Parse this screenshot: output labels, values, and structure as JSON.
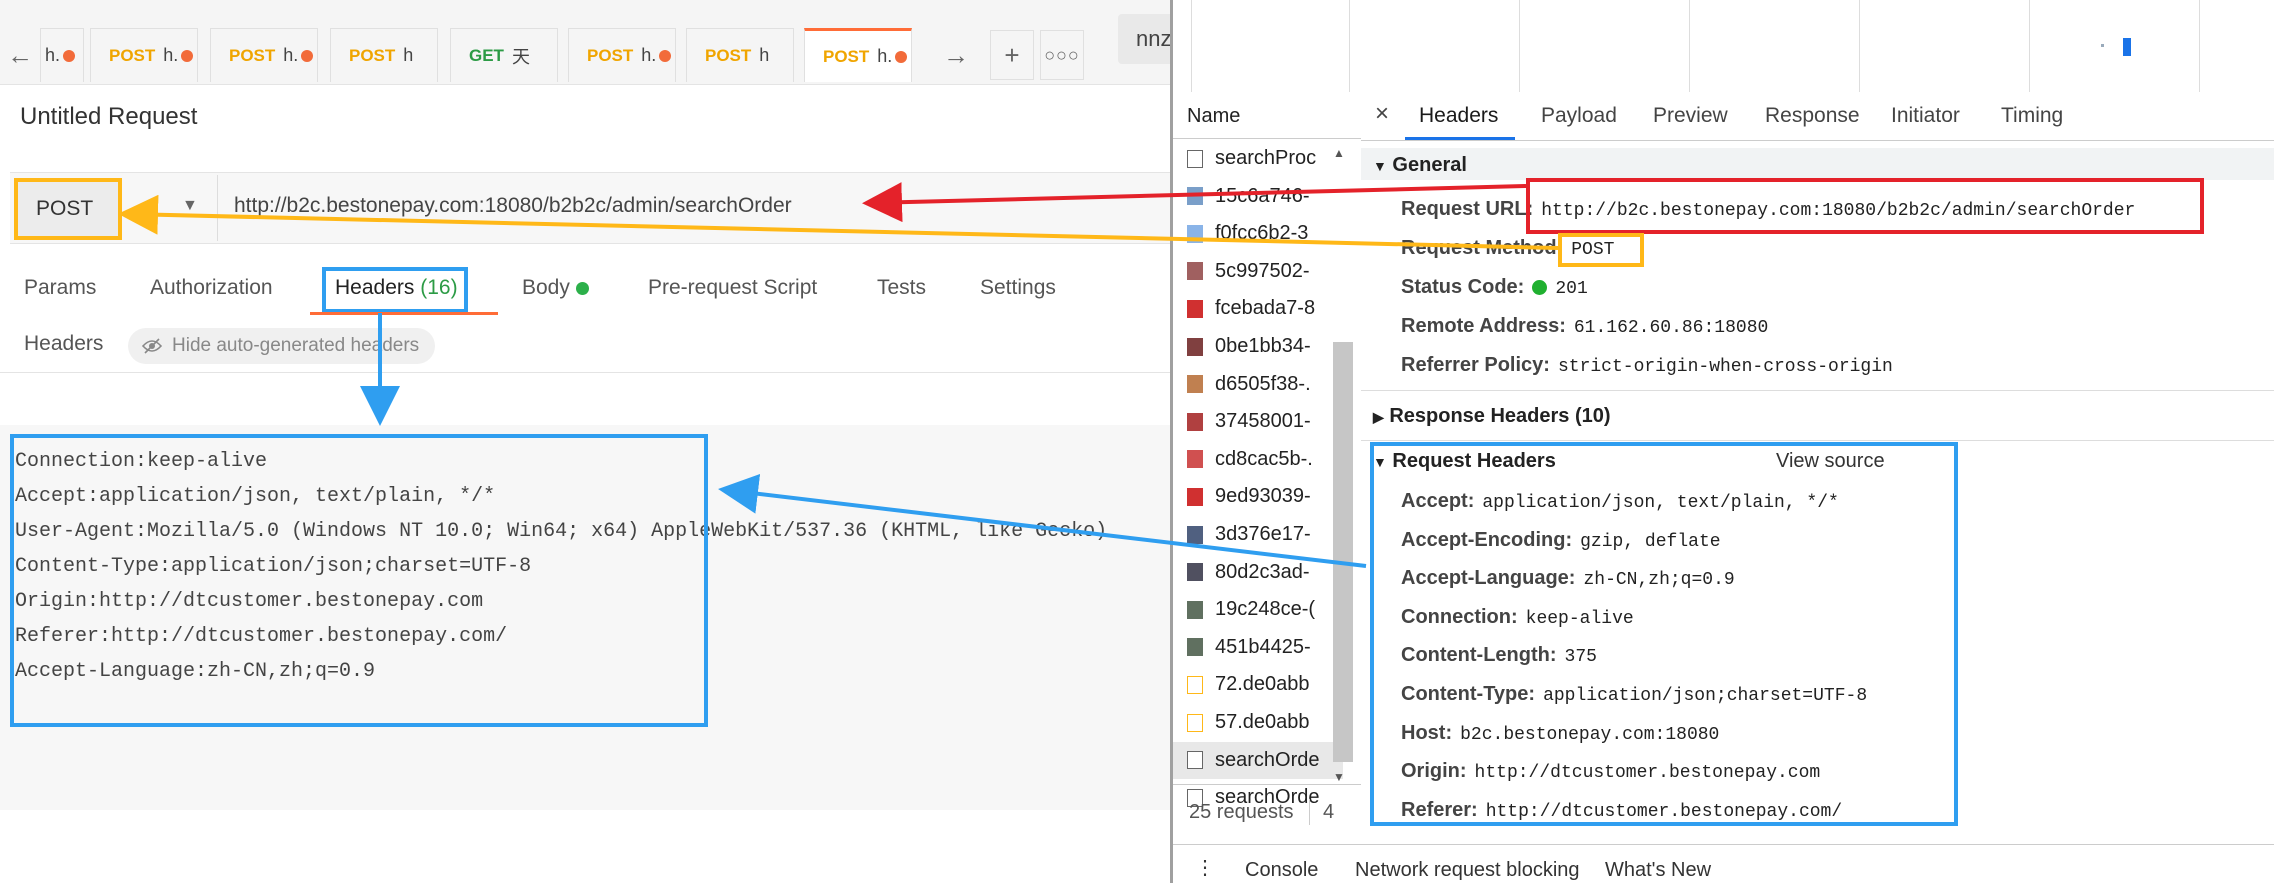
{
  "postman": {
    "tabs": [
      {
        "method": "",
        "label": "h.",
        "dirty": true
      },
      {
        "method": "POST",
        "label": "h.",
        "dirty": true
      },
      {
        "method": "POST",
        "label": "h.",
        "dirty": true
      },
      {
        "method": "POST",
        "label": "h",
        "dirty": false
      },
      {
        "method": "GET",
        "label": "天",
        "dirty": false
      },
      {
        "method": "POST",
        "label": "h.",
        "dirty": true
      },
      {
        "method": "POST",
        "label": "h",
        "dirty": false
      },
      {
        "method": "POST",
        "label": "h.",
        "dirty": true
      }
    ],
    "workspace_label": "nnz",
    "request_title": "Untitled Request",
    "method": "POST",
    "url": "http://b2c.bestonepay.com:18080/b2b2c/admin/searchOrder",
    "request_tabs": {
      "params": "Params",
      "authorization": "Authorization",
      "headers": "Headers",
      "headers_count": "(16)",
      "body": "Body",
      "prerequest": "Pre-request Script",
      "tests": "Tests",
      "settings": "Settings"
    },
    "headers_section": "Headers",
    "hide_auto": "Hide auto-generated headers",
    "bulk_headers": [
      "Connection:keep-alive",
      "Accept:application/json, text/plain, */*",
      "User-Agent:Mozilla/5.0 (Windows NT 10.0; Win64; x64) AppleWebKit/537.36 (KHTML, like Gecko)",
      "Content-Type:application/json;charset=UTF-8",
      "Origin:http://dtcustomer.bestonepay.com",
      "Referer:http://dtcustomer.bestonepay.com/",
      "Accept-Language:zh-CN,zh;q=0.9"
    ]
  },
  "devtools": {
    "name_header": "Name",
    "requests": [
      "searchProc",
      "15c6a746-",
      "f0fcc6b2-3",
      "5c997502-",
      "fcebada7-8",
      "0be1bb34-",
      "d6505f38-.",
      "37458001-",
      "cd8cac5b-.",
      "9ed93039-",
      "3d376e17-",
      "80d2c3ad-",
      "19c248ce-(",
      "451b4425-",
      "72.de0abb",
      "57.de0abb",
      "searchOrde",
      "searchOrde"
    ],
    "request_count": "25 requests",
    "request_count_extra": "4",
    "detail_tabs": [
      "Headers",
      "Payload",
      "Preview",
      "Response",
      "Initiator",
      "Timing"
    ],
    "close_label": "×",
    "general_title": "General",
    "general": [
      {
        "key": "Request URL:",
        "value": "http://b2c.bestonepay.com:18080/b2b2c/admin/searchOrder"
      },
      {
        "key": "Request Method:",
        "value": "POST"
      },
      {
        "key": "Status Code:",
        "value": "201"
      },
      {
        "key": "Remote Address:",
        "value": "61.162.60.86:18080"
      },
      {
        "key": "Referrer Policy:",
        "value": "strict-origin-when-cross-origin"
      }
    ],
    "response_headers_title": "Response Headers (10)",
    "request_headers_title": "Request Headers",
    "view_source": "View source",
    "request_headers": [
      {
        "key": "Accept:",
        "value": "application/json, text/plain, */*"
      },
      {
        "key": "Accept-Encoding:",
        "value": "gzip, deflate"
      },
      {
        "key": "Accept-Language:",
        "value": "zh-CN,zh;q=0.9"
      },
      {
        "key": "Connection:",
        "value": "keep-alive"
      },
      {
        "key": "Content-Length:",
        "value": "375"
      },
      {
        "key": "Content-Type:",
        "value": "application/json;charset=UTF-8"
      },
      {
        "key": "Host:",
        "value": "b2c.bestonepay.com:18080"
      },
      {
        "key": "Origin:",
        "value": "http://dtcustomer.bestonepay.com"
      },
      {
        "key": "Referer:",
        "value": "http://dtcustomer.bestonepay.com/"
      }
    ],
    "drawer": {
      "console": "Console",
      "network_blocking": "Network request blocking",
      "whats_new": "What's New"
    }
  },
  "colors": {
    "accent_orange": "#ff6c37",
    "post": "#f0a500",
    "get": "#2c9b45",
    "annot_red": "#e4222a",
    "annot_yellow": "#ffb818",
    "annot_blue": "#2f9ef0",
    "devtools_blue": "#1a73e8"
  }
}
